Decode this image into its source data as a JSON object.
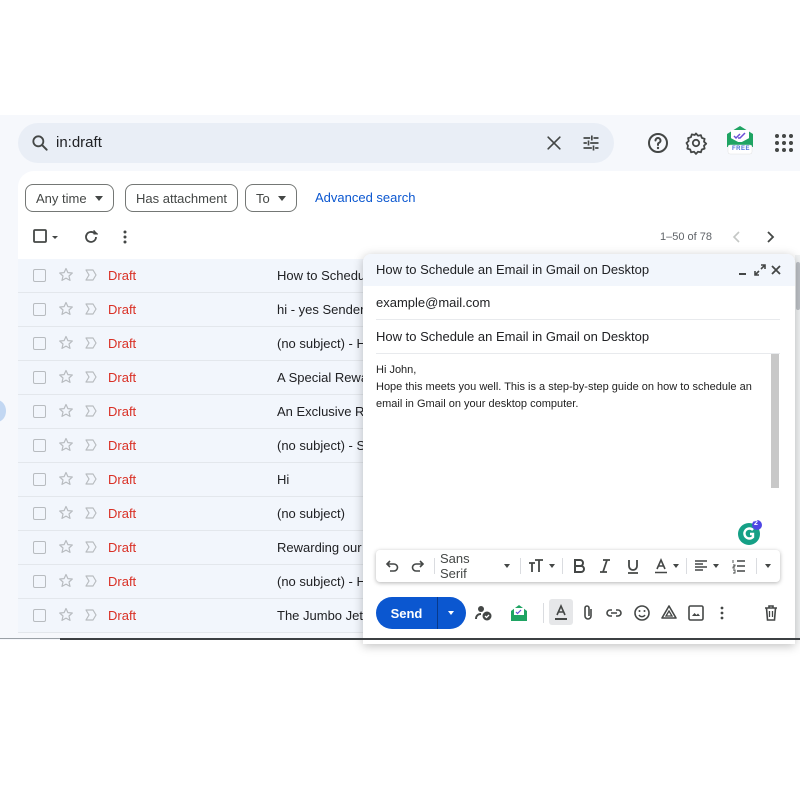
{
  "search": {
    "query": "in:draft",
    "icon": "search-icon",
    "clear_icon": "close-icon",
    "options_icon": "search-options-icon"
  },
  "header_icons": {
    "help": "help-icon",
    "settings": "gear-icon",
    "extension_badge": "FREE",
    "apps": "apps-grid-icon"
  },
  "filters": {
    "any_time": "Any time",
    "has_attachment": "Has attachment",
    "to": "To",
    "advanced_search": "Advanced search"
  },
  "list_toolbar": {
    "pagination": "1–50 of 78"
  },
  "emails": [
    {
      "label": "Draft",
      "subject": "How to Schedul"
    },
    {
      "label": "Draft",
      "subject": "hi - yes Sender"
    },
    {
      "label": "Draft",
      "subject": "(no subject) - H"
    },
    {
      "label": "Draft",
      "subject": "A Special Rewar"
    },
    {
      "label": "Draft",
      "subject": "An Exclusive Re"
    },
    {
      "label": "Draft",
      "subject": "(no subject) - S"
    },
    {
      "label": "Draft",
      "subject": "Hi"
    },
    {
      "label": "Draft",
      "subject": "(no subject)"
    },
    {
      "label": "Draft",
      "subject": "Rewarding our A"
    },
    {
      "label": "Draft",
      "subject": "(no subject) - H"
    },
    {
      "label": "Draft",
      "subject": "The Jumbo Jet C"
    }
  ],
  "compose": {
    "title": "How to Schedule an Email in Gmail on Desktop",
    "to": "example@mail.com",
    "subject": "How to Schedule an Email in Gmail on Desktop",
    "body_line1": "Hi John,",
    "body_line2": "Hope this meets you well. This is a step-by-step guide on how to schedule an",
    "body_line3": "email in Gmail on your desktop computer.",
    "grammarly_count": "2",
    "font_name": "Sans Serif",
    "send_label": "Send"
  },
  "colors": {
    "accent": "#0b57d0",
    "draft_label": "#d93025",
    "search_bg": "#e9eef6",
    "row_bg": "#f2f6fc"
  }
}
